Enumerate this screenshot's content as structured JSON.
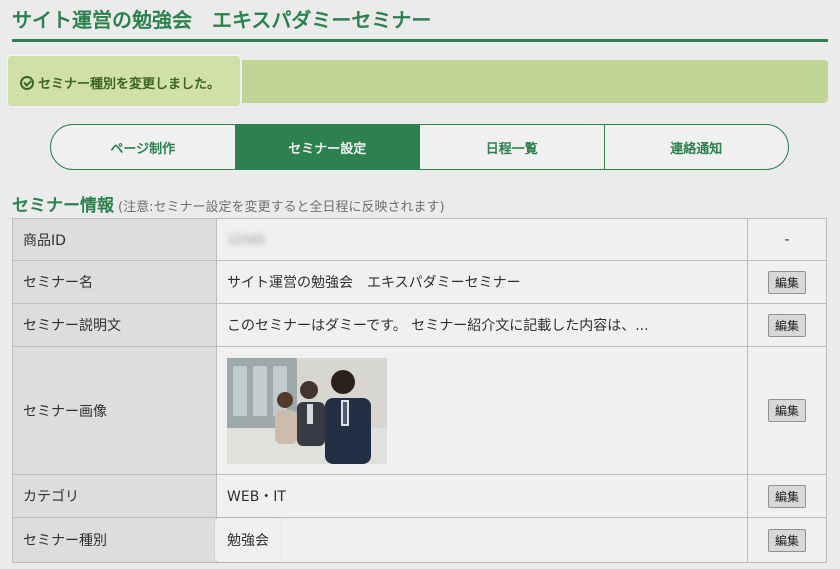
{
  "page": {
    "title": "サイト運営の勉強会　エキスパダミーセミナー"
  },
  "alert": {
    "icon": "check-circle-icon",
    "message": "セミナー種別を変更しました。"
  },
  "tabs": [
    {
      "label": "ページ制作",
      "active": false
    },
    {
      "label": "セミナー設定",
      "active": true
    },
    {
      "label": "日程一覧",
      "active": false
    },
    {
      "label": "連絡通知",
      "active": false
    }
  ],
  "section": {
    "title": "セミナー情報",
    "note": "(注意:セミナー設定を変更すると全日程に反映されます)"
  },
  "table": {
    "edit_label": "編集",
    "rows": [
      {
        "label": "商品ID",
        "value": "12345",
        "action": "-"
      },
      {
        "label": "セミナー名",
        "value": "サイト運営の勉強会　エキスパダミーセミナー"
      },
      {
        "label": "セミナー説明文",
        "value": "このセミナーはダミーです。 セミナー紹介文に記載した内容は、..."
      },
      {
        "label": "セミナー画像",
        "value": ""
      },
      {
        "label": "カテゴリ",
        "value": "WEB・IT"
      },
      {
        "label": "セミナー種別",
        "value": "勉強会"
      }
    ]
  },
  "colors": {
    "brand": "#2f8a54",
    "alert_bg": "#cde4a0",
    "alert_text": "#3e6d23"
  }
}
